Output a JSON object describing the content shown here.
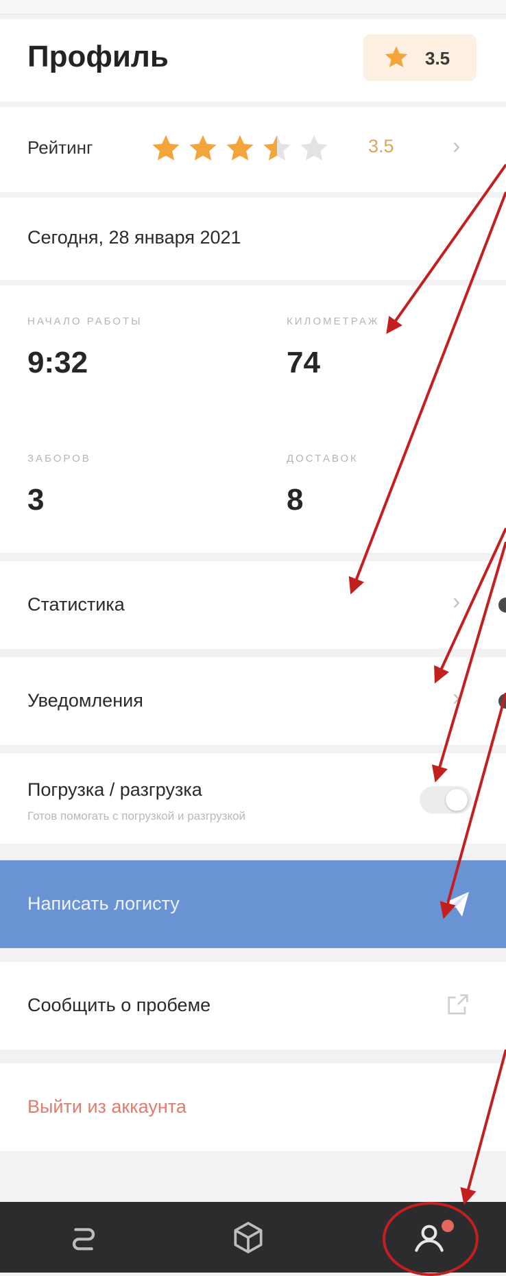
{
  "header": {
    "title": "Профиль",
    "rating_badge": "3.5"
  },
  "rating": {
    "label": "Рейтинг",
    "value": "3.5",
    "stars_filled": 3.5,
    "stars_total": 5
  },
  "date": {
    "text": "Сегодня, 28 января 2021"
  },
  "stats": [
    {
      "label": "Начало работы",
      "value": "9:32"
    },
    {
      "label": "Километраж",
      "value": "74"
    },
    {
      "label": "Заборов",
      "value": "3"
    },
    {
      "label": "Доставок",
      "value": "8"
    }
  ],
  "menu": {
    "statistics": "Статистика",
    "notifications": "Уведомления",
    "loading_title": "Погрузка / разгрузка",
    "loading_subtitle": "Готов помогать с погрузкой и разгрузкой",
    "loading_enabled": false,
    "write_logist": "Написать логисту",
    "report_problem": "Сообщить о пробеме",
    "logout": "Выйти из аккаунта"
  },
  "tabbar": {
    "items": [
      "routes-icon",
      "package-icon",
      "profile-icon"
    ],
    "active": "profile-icon"
  },
  "colors": {
    "accent": "#6a93d3",
    "star": "#f3a53b",
    "badge_bg": "#fdf0e3",
    "logout": "#e07b6f",
    "annotation": "#c31f1f",
    "tabbar": "#2c2c2e"
  }
}
